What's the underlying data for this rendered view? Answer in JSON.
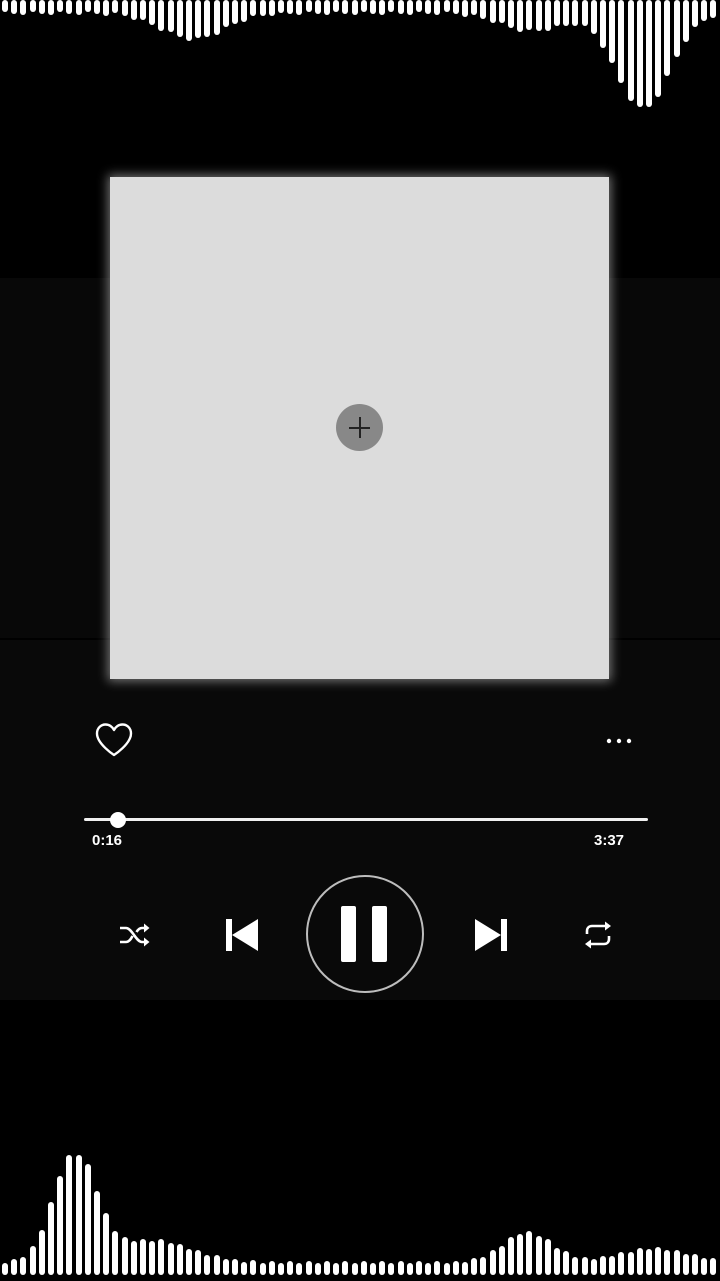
{
  "player": {
    "elapsed_time": "0:16",
    "total_time": "3:37",
    "progress_fraction": 0.06,
    "is_playing": true
  },
  "icons": {
    "add_art": "plus-icon",
    "like": "heart-outline-icon",
    "more": "more-horizontal-icon",
    "shuffle": "shuffle-icon",
    "previous": "skip-previous-icon",
    "pause": "pause-icon",
    "next": "skip-next-icon",
    "repeat": "repeat-icon"
  },
  "colors": {
    "background": "#000000",
    "album_placeholder": "#dcdcdc",
    "foreground": "#ffffff"
  }
}
